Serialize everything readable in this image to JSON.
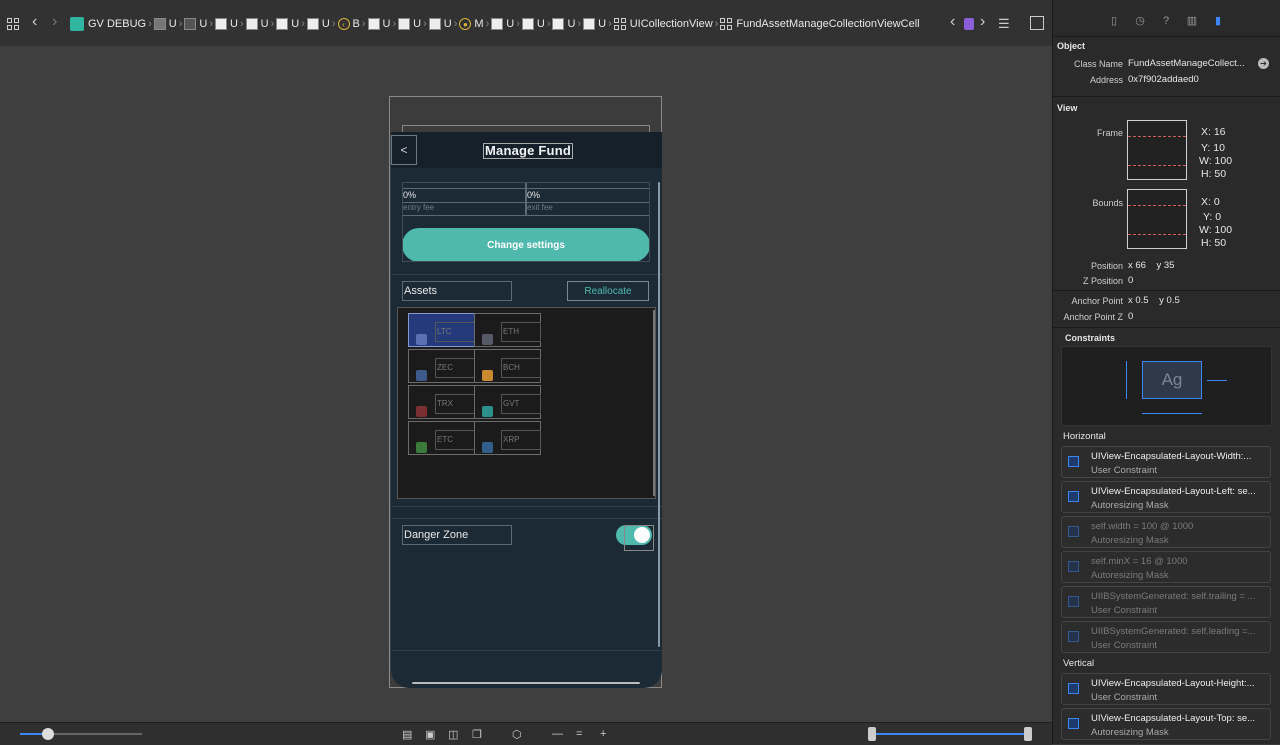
{
  "breadcrumb": {
    "app": "GV DEBUG",
    "items": [
      "U",
      "U",
      "U",
      "U",
      "U",
      "U",
      "B",
      "U",
      "U",
      "U",
      "M",
      "U",
      "U",
      "U",
      "U"
    ],
    "collection_view": "UICollectionView",
    "cell": "FundAssetManageCollectionViewCell"
  },
  "phone": {
    "back_glyph": "<",
    "title": "Manage Fund",
    "entry_value": "0%",
    "entry_label": "entry fee",
    "exit_value": "0%",
    "exit_label": "exit fee",
    "change_settings": "Change settings",
    "assets_label": "Assets",
    "reallocate": "Reallocate",
    "assets": [
      {
        "name": "LTC",
        "icon_color": "#5b6fb3",
        "selected": true
      },
      {
        "name": "ETH",
        "icon_color": "#555a66",
        "selected": false
      },
      {
        "name": "ZEC",
        "icon_color": "#3d5a8a",
        "selected": false
      },
      {
        "name": "BCH",
        "icon_color": "#c98a2e",
        "selected": false
      },
      {
        "name": "TRX",
        "icon_color": "#7a3030",
        "selected": false
      },
      {
        "name": "GVT",
        "icon_color": "#2b8f8a",
        "selected": false
      },
      {
        "name": "ETC",
        "icon_color": "#3a7a3a",
        "selected": false
      },
      {
        "name": "XRP",
        "icon_color": "#2f5f8a",
        "selected": false
      }
    ],
    "danger_zone": "Danger Zone",
    "toggle_on": true
  },
  "inspector": {
    "object_header": "Object",
    "class_name_label": "Class Name",
    "class_name_value": "FundAssetManageCollect...",
    "address_label": "Address",
    "address_value": "0x7f902addaed0",
    "view_header": "View",
    "frame_label": "Frame",
    "frame": {
      "x": "X: 16",
      "y": "Y: 10",
      "w": "W: 100",
      "h": "H: 50"
    },
    "bounds_label": "Bounds",
    "bounds": {
      "x": "X: 0",
      "y": "Y: 0",
      "w": "W: 100",
      "h": "H: 50"
    },
    "position_label": "Position",
    "position_value": "x 66    y 35",
    "zpos_label": "Z Position",
    "zpos_value": "0",
    "anchor_label": "Anchor Point",
    "anchor_value": "x 0.5    y 0.5",
    "anchorz_label": "Anchor Point Z",
    "anchorz_value": "0",
    "constraints_header": "Constraints",
    "constraints_preview": "Ag",
    "horizontal_header": "Horizontal",
    "horizontal": [
      {
        "title": "UIView-Encapsulated-Layout-Width:...",
        "sub": "User Constraint",
        "dim": false
      },
      {
        "title": "UIView-Encapsulated-Layout-Left: se...",
        "sub": "Autoresizing Mask",
        "dim": false
      },
      {
        "title": "self.width = 100 @ 1000",
        "sub": "Autoresizing Mask",
        "dim": true
      },
      {
        "title": "self.minX = 16 @ 1000",
        "sub": "Autoresizing Mask",
        "dim": true
      },
      {
        "title": "UIIBSystemGenerated: self.trailing = ...",
        "sub": "User Constraint",
        "dim": true
      },
      {
        "title": "UIIBSystemGenerated: self.leading =...",
        "sub": "User Constraint",
        "dim": true
      }
    ],
    "vertical_header": "Vertical",
    "vertical": [
      {
        "title": "UIView-Encapsulated-Layout-Height:...",
        "sub": "User Constraint",
        "dim": false
      },
      {
        "title": "UIView-Encapsulated-Layout-Top: se...",
        "sub": "Autoresizing Mask",
        "dim": false
      }
    ]
  },
  "colors": {
    "accent": "#4fb9ad",
    "selection_blue": "#3d86f5",
    "phone_bg": "#1c2a36"
  }
}
